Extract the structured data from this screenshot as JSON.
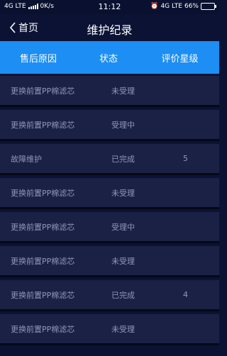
{
  "status_bar": {
    "network": "4G LTE",
    "speed": "0K/s",
    "time": "11:12",
    "right_network": "4G LTE",
    "battery": "66%",
    "battery_level": 0.66
  },
  "nav": {
    "back_label": "首页",
    "title": "维护纪录"
  },
  "table": {
    "headers": [
      "售后原因",
      "状态",
      "评价星级"
    ],
    "rows": [
      {
        "reason": "更换前置PP棉滤芯",
        "status": "未受理",
        "rating": ""
      },
      {
        "reason": "更换前置PP棉滤芯",
        "status": "受理中",
        "rating": ""
      },
      {
        "reason": "故障维护",
        "status": "已完成",
        "rating": "5"
      },
      {
        "reason": "更换前置PP棉滤芯",
        "status": "未受理",
        "rating": ""
      },
      {
        "reason": "更换前置PP棉滤芯",
        "status": "受理中",
        "rating": ""
      },
      {
        "reason": "更换前置PP棉滤芯",
        "status": "未受理",
        "rating": ""
      },
      {
        "reason": "更换前置PP棉滤芯",
        "status": "已完成",
        "rating": "4"
      },
      {
        "reason": "更换前置PP棉滤芯",
        "status": "未受理",
        "rating": ""
      }
    ]
  },
  "colors": {
    "background": "#0b1233",
    "header_bar": "#1d8ef3",
    "row_bg": "#1b2145",
    "row_text": "#8f97b8"
  }
}
